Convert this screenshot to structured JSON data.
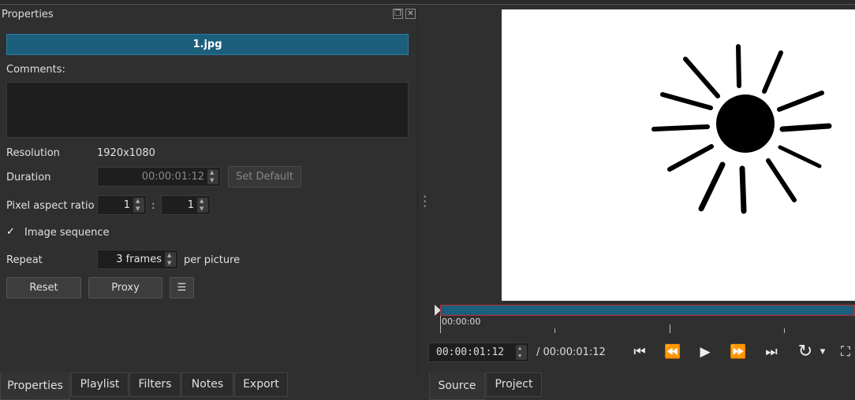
{
  "properties": {
    "panel_title": "Properties",
    "clip_name": "1.jpg",
    "comments_label": "Comments:",
    "resolution_label": "Resolution",
    "resolution_value": "1920x1080",
    "duration_label": "Duration",
    "duration_value": "00:00:01:12",
    "set_default_label": "Set Default",
    "par_label": "Pixel aspect ratio",
    "par_num": "1",
    "par_sep": ":",
    "par_den": "1",
    "image_sequence_label": "Image sequence",
    "image_sequence_check": "✓",
    "repeat_label": "Repeat",
    "repeat_value": "3 frames",
    "per_picture_label": "per picture",
    "reset_label": "Reset",
    "proxy_label": "Proxy",
    "menu_glyph": "☰"
  },
  "left_tabs": [
    "Properties",
    "Playlist",
    "Filters",
    "Notes",
    "Export"
  ],
  "right_tabs": [
    "Source",
    "Project"
  ],
  "player": {
    "ruler_start": "00:00:00",
    "current_time": "00:00:01:12",
    "total_time": "/ 00:00:01:12",
    "buttons": {
      "skip_prev": "⏮",
      "rewind": "⏪",
      "play": "▶",
      "fast_forward": "⏩",
      "skip_next": "⏭",
      "loop": "↻",
      "loop_menu": "▾",
      "zoom": "⛶"
    }
  },
  "colors": {
    "accent": "#1c5f7d",
    "playhead": "#c03030"
  }
}
